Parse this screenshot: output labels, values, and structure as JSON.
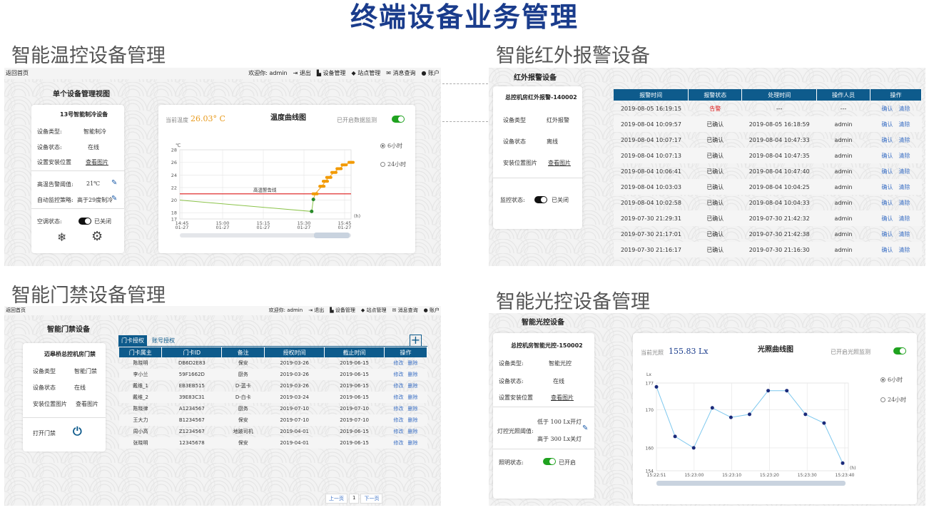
{
  "main_title": "终端设备业务管理",
  "sections": {
    "temp": "智能温控设备管理",
    "infrared": "智能红外报警设备",
    "door": "智能门禁设备管理",
    "light": "智能光控设备管理"
  },
  "topbar": {
    "back": "返回首页",
    "welcome": "欢迎你: admin",
    "logout": "退出",
    "device_mgmt": "设备管理",
    "site_mgmt": "站点管理",
    "msg_query": "消息查询",
    "account": "账户"
  },
  "temp": {
    "view_title": "单个设备管理视图",
    "device_name": "13号智能制冷设备",
    "type_label": "设备类型:",
    "type_value": "智能制冷",
    "status_label": "设备状态:",
    "status_value": "在线",
    "install_label": "设置安装位置",
    "install_link": "查看图片",
    "alarm_label": "高温告警阈值:",
    "alarm_value": "21℃",
    "auto_label": "自动监控策略:",
    "auto_value": "高于29度制冷",
    "ac_label": "空调状态:",
    "ac_value": "已关闭",
    "current_label": "当前温度",
    "current_value": "26.03° C",
    "chart_title": "温度曲线图",
    "monitor_label": "已开启数据监测",
    "radio_6h": "6小时",
    "radio_24h": "24小时",
    "alarm_line_label": "高温警告线"
  },
  "infrared": {
    "header": "红外报警设备",
    "device_name": "总控机房红外报警-140002",
    "type_label": "设备类型",
    "type_value": "红外报警",
    "status_label": "设备状态",
    "status_value": "离线",
    "install_label": "安装位置图片",
    "install_link": "查看图片",
    "monitor_label": "监控状态:",
    "monitor_value": "已关闭",
    "columns": [
      "报警时间",
      "报警状态",
      "处理时间",
      "操作人员",
      "操作"
    ],
    "confirm": "确认",
    "clear": "清除",
    "rows": [
      [
        "2019-08-05 16:19:15",
        "告警",
        "---",
        "---"
      ],
      [
        "2019-08-04 10:09:57",
        "已确认",
        "2019-08-05 16:18:59",
        "admin"
      ],
      [
        "2019-08-04 10:07:17",
        "已确认",
        "2019-08-04 10:47:33",
        "admin"
      ],
      [
        "2019-08-04 10:07:13",
        "已确认",
        "2019-08-04 10:47:35",
        "admin"
      ],
      [
        "2019-08-04 10:06:41",
        "已确认",
        "2019-08-04 10:47:40",
        "admin"
      ],
      [
        "2019-08-04 10:03:03",
        "已确认",
        "2019-08-04 10:04:25",
        "admin"
      ],
      [
        "2019-08-04 10:02:58",
        "已确认",
        "2019-08-04 10:04:33",
        "admin"
      ],
      [
        "2019-07-30 21:29:31",
        "已确认",
        "2019-07-30 21:42:32",
        "admin"
      ],
      [
        "2019-07-30 21:17:01",
        "已确认",
        "2019-07-30 21:42:38",
        "admin"
      ],
      [
        "2019-07-30 21:16:17",
        "已确认",
        "2019-07-30 21:16:30",
        "admin"
      ]
    ]
  },
  "door": {
    "header": "智能门禁设备",
    "device_name": "迈皋桥总控机房门禁",
    "type_label": "设备类型",
    "type_value": "智能门禁",
    "status_label": "设备状态",
    "status_value": "在线",
    "install_label": "安装位置图片",
    "install_link": "查看图片",
    "open_label": "打开门禁",
    "tab1": "门卡授权",
    "tab2": "账号授权",
    "columns": [
      "门卡属主",
      "门卡ID",
      "备注",
      "授权时间",
      "截止时间",
      "操作"
    ],
    "edit": "修改",
    "delete": "删除",
    "rows": [
      [
        "陈晓明",
        "DB6D2E83",
        "保安",
        "2019-03-26",
        "2019-06-15"
      ],
      [
        "李小兰",
        "59F1662D",
        "厨务",
        "2019-03-26",
        "2019-06-15"
      ],
      [
        "戴维_1",
        "EB3EB515",
        "D-蓝卡",
        "2019-03-26",
        "2019-06-15"
      ],
      [
        "戴维_2",
        "39E83C31",
        "D-白卡",
        "2019-03-24",
        "2019-06-15"
      ],
      [
        "陈晓律",
        "A1234567",
        "厨务",
        "2019-07-10",
        "2019-07-10"
      ],
      [
        "王大力",
        "B1234567",
        "保安",
        "2019-07-10",
        "2019-07-10"
      ],
      [
        "周小高",
        "Z1234567",
        "地跛司机",
        "2019-04-01",
        "2019-06-15"
      ],
      [
        "张晓明",
        "12345678",
        "保安",
        "2019-04-01",
        "2019-06-15"
      ]
    ],
    "prev": "上一页",
    "page": "1",
    "next": "下一页"
  },
  "light": {
    "header": "智能光控设备",
    "device_name": "总控机房智能光控-150002",
    "type_label": "设备类型:",
    "type_value": "智能光控",
    "status_label": "设备状态:",
    "status_value": "在线",
    "install_label": "设置安装位置",
    "install_link": "查看图片",
    "threshold_label": "灯控光照阈值:",
    "low_text": "低于 100 Lx开灯",
    "high_text": "高于 300 Lx关灯",
    "lamp_label": "照明状态:",
    "lamp_value": "已开启",
    "current_label": "当前光照",
    "current_value": "155.83 Lx",
    "chart_title": "光照曲线图",
    "monitor_label": "已开启光照监测",
    "radio_6h": "6小时",
    "radio_24h": "24小时"
  },
  "chart_data": [
    {
      "type": "line",
      "title": "温度曲线图",
      "xlabel": "(h)",
      "ylabel": "℃",
      "x": [
        "14:45 01-27",
        "15:00 01-27",
        "15:15 01-27",
        "15:30 01-27",
        "15:45 01-27"
      ],
      "ylim": [
        17,
        28
      ],
      "yticks": [
        17,
        18,
        20,
        22,
        24,
        26,
        28
      ],
      "alarm_threshold": 21,
      "series": [
        {
          "values_t": [
            0,
            0.77,
            0.78,
            0.79,
            0.83,
            0.85,
            0.87,
            0.9,
            0.93,
            0.96,
            1.0
          ],
          "values": [
            20,
            18.2,
            20.1,
            21,
            22.2,
            23,
            23.6,
            24.4,
            25,
            25.6,
            26
          ]
        }
      ]
    },
    {
      "type": "line",
      "title": "光照曲线图",
      "xlabel": "(h)",
      "ylabel": "Lx",
      "x": [
        "15:22:51",
        "15:23:00",
        "15:23:10",
        "15:23:20",
        "15:23:30",
        "15:23:40"
      ],
      "ylim": [
        154,
        177
      ],
      "yticks": [
        154,
        160,
        170,
        177
      ],
      "series": [
        {
          "values": [
            176,
            163,
            160,
            170.5,
            168,
            168.8,
            175,
            175,
            168.8,
            166.5,
            156
          ]
        }
      ]
    }
  ]
}
